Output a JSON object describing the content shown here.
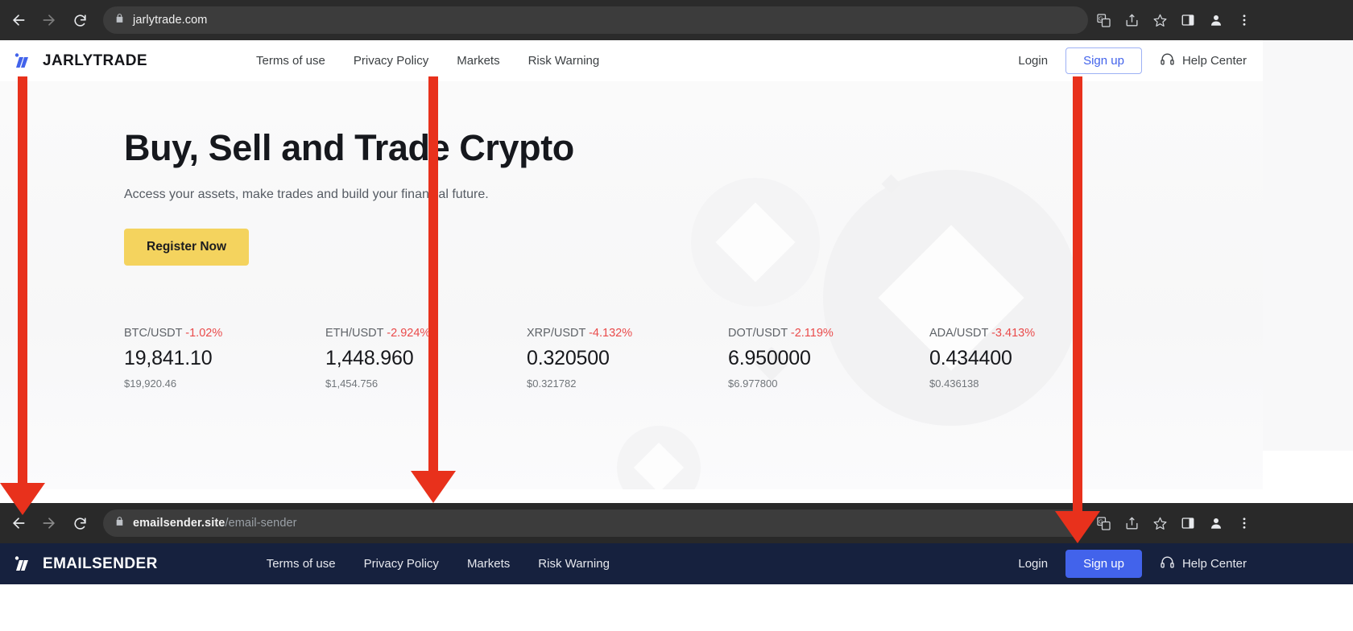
{
  "top_browser": {
    "url_host": "jarlytrade.com",
    "url_path": "",
    "back_icon": "back-arrow-icon",
    "forward_icon": "forward-arrow-icon",
    "reload_icon": "reload-icon",
    "lock_icon": "lock-icon",
    "toolbar_icons": [
      "translate-icon",
      "share-icon",
      "bookmark-star-icon",
      "sidepanel-icon",
      "profile-icon",
      "more-menu-icon"
    ]
  },
  "top_site": {
    "logo_text": "JARLYTRADE",
    "nav_links": [
      {
        "label": "Terms of use"
      },
      {
        "label": "Privacy Policy"
      },
      {
        "label": "Markets"
      },
      {
        "label": "Risk Warning"
      }
    ],
    "login_label": "Login",
    "signup_label": "Sign up",
    "help_label": "Help Center",
    "hero": {
      "heading": "Buy, Sell and Trade Crypto",
      "subheading": "Access your assets, make trades and build your financial future.",
      "cta_label": "Register Now",
      "cta_color": "#f4d35e"
    },
    "tickers": [
      {
        "pair": "BTC/USDT",
        "change": "-1.02%",
        "price": "19,841.10",
        "usd": "$19,920.46"
      },
      {
        "pair": "ETH/USDT",
        "change": "-2.924%",
        "price": "1,448.960",
        "usd": "$1,454.756"
      },
      {
        "pair": "XRP/USDT",
        "change": "-4.132%",
        "price": "0.320500",
        "usd": "$0.321782"
      },
      {
        "pair": "DOT/USDT",
        "change": "-2.119%",
        "price": "6.950000",
        "usd": "$6.977800"
      },
      {
        "pair": "ADA/USDT",
        "change": "-3.413%",
        "price": "0.434400",
        "usd": "$0.436138"
      }
    ],
    "change_color": "#ea4b4b"
  },
  "bottom_browser": {
    "url_host": "emailsender.site",
    "url_path": "/email-sender",
    "back_icon": "back-arrow-icon",
    "forward_icon": "forward-arrow-icon",
    "reload_icon": "reload-icon",
    "lock_icon": "lock-icon",
    "toolbar_icons": [
      "translate-icon",
      "share-icon",
      "bookmark-star-icon",
      "sidepanel-icon",
      "profile-icon",
      "more-menu-icon"
    ]
  },
  "bottom_site": {
    "logo_text": "EMAILSENDER",
    "nav_links": [
      {
        "label": "Terms of use"
      },
      {
        "label": "Privacy Policy"
      },
      {
        "label": "Markets"
      },
      {
        "label": "Risk Warning"
      }
    ],
    "login_label": "Login",
    "signup_label": "Sign up",
    "help_label": "Help Center",
    "navbar_color": "#16213e",
    "signup_color": "#4263eb"
  },
  "annotations": {
    "arrow_color": "#e8311c",
    "arrows": [
      {
        "name": "arrow-logo"
      },
      {
        "name": "arrow-nav-links"
      },
      {
        "name": "arrow-signup"
      }
    ]
  }
}
